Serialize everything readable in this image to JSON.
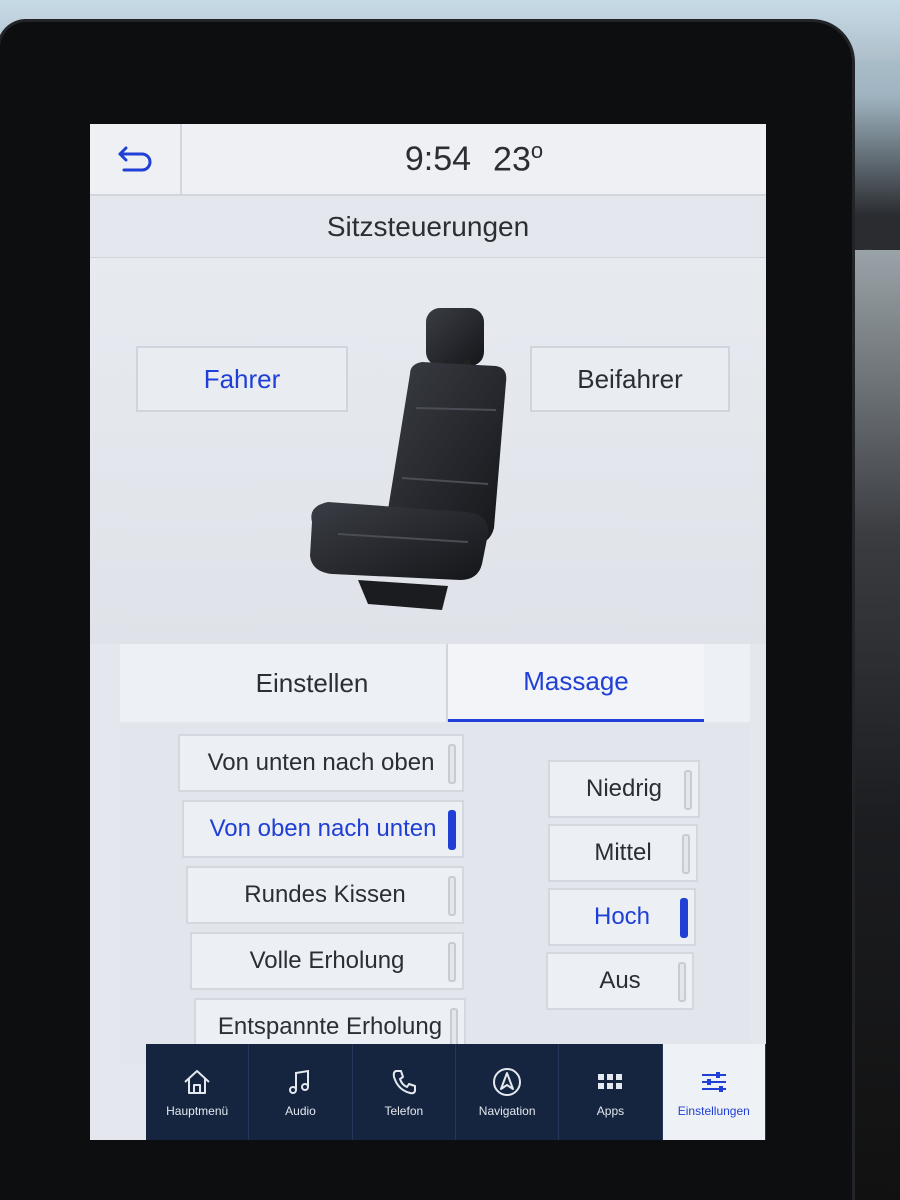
{
  "status": {
    "time": "9:54",
    "temperature": "23",
    "temperature_unit": "o"
  },
  "page_title": "Sitzsteuerungen",
  "seat_selector": {
    "driver_label": "Fahrer",
    "passenger_label": "Beifahrer",
    "selected": "Fahrer"
  },
  "tabs": [
    {
      "label": "Einstellen",
      "active": false
    },
    {
      "label": "Massage",
      "active": true
    }
  ],
  "massage_programs": [
    {
      "label": "Von unten nach oben",
      "active": false
    },
    {
      "label": "Von oben nach unten",
      "active": true
    },
    {
      "label": "Rundes Kissen",
      "active": false
    },
    {
      "label": "Volle Erholung",
      "active": false
    },
    {
      "label": "Entspannte Erholung",
      "active": false
    }
  ],
  "intensity": [
    {
      "label": "Niedrig",
      "active": false
    },
    {
      "label": "Mittel",
      "active": false
    },
    {
      "label": "Hoch",
      "active": true
    },
    {
      "label": "Aus",
      "active": false
    }
  ],
  "nav": [
    {
      "label": "Hauptmenü",
      "icon": "home-icon"
    },
    {
      "label": "Audio",
      "icon": "music-note-icon"
    },
    {
      "label": "Telefon",
      "icon": "phone-icon"
    },
    {
      "label": "Navigation",
      "icon": "navigation-arrow-icon"
    },
    {
      "label": "Apps",
      "icon": "apps-grid-icon"
    },
    {
      "label": "Einstellungen",
      "icon": "settings-sliders-icon",
      "active": true
    }
  ],
  "colors": {
    "accent": "#1f3fd6",
    "nav_background": "#15243f",
    "screen_background": "#e4e8ee"
  }
}
